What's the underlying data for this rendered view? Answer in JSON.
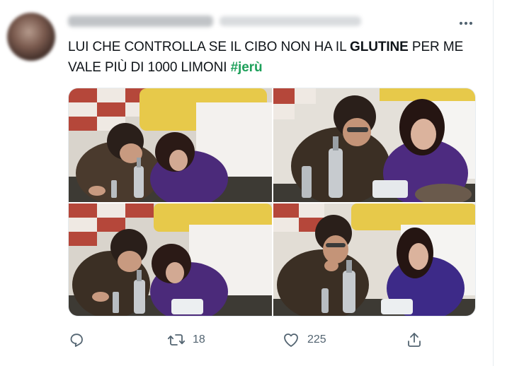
{
  "tweet": {
    "text_part1": "LUI CHE CONTROLLA SE IL CIBO NON HA IL ",
    "text_bold": "GLUTINE",
    "text_part2": " PER ME VALE PIÙ DI 1000 LIMONI  ",
    "hashtag": "#jerù"
  },
  "actions": {
    "retweet_count": "18",
    "like_count": "225"
  },
  "colors": {
    "hashtag": "#1da05a",
    "secondary_text": "#536471",
    "border": "#e6ecf0"
  },
  "icons": {
    "more": "more-horizontal-icon",
    "reply": "reply-icon",
    "retweet": "retweet-icon",
    "like": "heart-icon",
    "share": "share-icon"
  }
}
